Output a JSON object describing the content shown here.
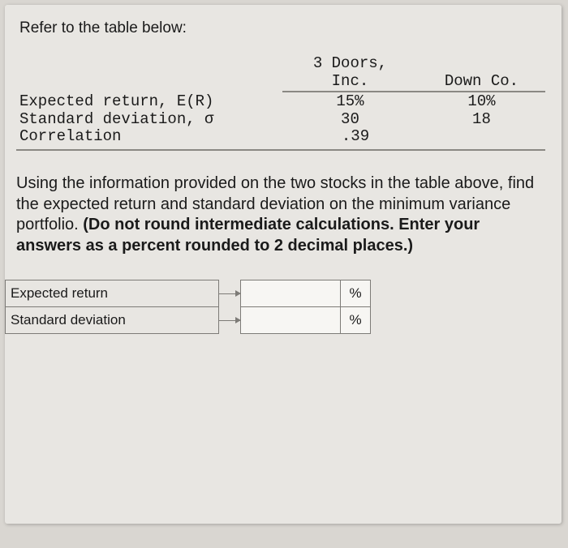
{
  "intro": "Refer to the table below:",
  "table": {
    "header_a_line1": "3 Doors,",
    "header_a_line2": "Inc.",
    "header_b": "Down Co.",
    "rows": [
      {
        "label": "Expected return, E(R)",
        "a": "15%",
        "b": "10%"
      },
      {
        "label": "Standard deviation, σ",
        "a": "30",
        "b": "18"
      }
    ],
    "corr_label": "Correlation",
    "corr_value": ".39"
  },
  "question_plain": "Using the information provided on the two stocks in the table above, find the expected return and standard deviation on the minimum variance portfolio. ",
  "question_bold": "(Do not round intermediate calculations. Enter your answers as a percent rounded to 2 decimal places.)",
  "answers": {
    "row1_label": "Expected return",
    "row2_label": "Standard deviation",
    "unit": "%"
  }
}
